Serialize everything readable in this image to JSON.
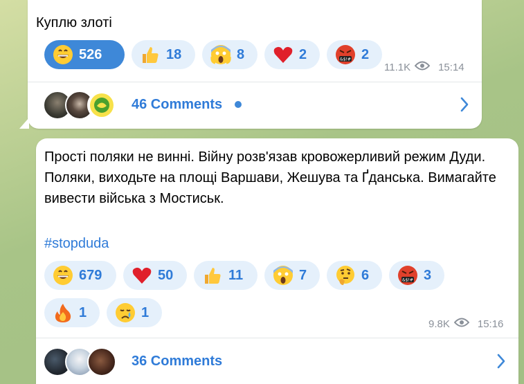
{
  "messages": [
    {
      "text": "Куплю злоті",
      "reactions": [
        {
          "icon": "grinning-face-emoji",
          "count": "526",
          "active": true
        },
        {
          "icon": "thumbs-up-emoji",
          "count": "18"
        },
        {
          "icon": "screaming-face-emoji",
          "count": "8"
        },
        {
          "icon": "red-heart-emoji",
          "count": "2"
        },
        {
          "icon": "cursing-face-emoji",
          "count": "2"
        }
      ],
      "views": "11.1K",
      "time": "15:14",
      "comments": "46 Comments",
      "has_unread": true
    },
    {
      "text": "Прості поляки не винні. Війну розв'язав кровожерливий режим Дуди. Поляки, виходьте на площі Варшави, Жешува та Ґданська. Вимагайте вивести війська з Мостиськ.",
      "hashtag": "#stopduda",
      "reactions": [
        {
          "icon": "grinning-face-emoji",
          "count": "679"
        },
        {
          "icon": "red-heart-emoji",
          "count": "50"
        },
        {
          "icon": "thumbs-up-emoji",
          "count": "11"
        },
        {
          "icon": "screaming-face-emoji",
          "count": "7"
        },
        {
          "icon": "thinking-face-emoji",
          "count": "6"
        },
        {
          "icon": "cursing-face-emoji",
          "count": "3"
        },
        {
          "icon": "fire-emoji",
          "count": "1"
        },
        {
          "icon": "crying-face-emoji",
          "count": "1"
        }
      ],
      "views": "9.8K",
      "time": "15:16",
      "comments": "36 Comments"
    }
  ],
  "colors": {
    "accent": "#3e88d8",
    "link": "#2f7bd8",
    "reaction_bg": "#e5f0fb",
    "meta_text": "#8a9099"
  }
}
